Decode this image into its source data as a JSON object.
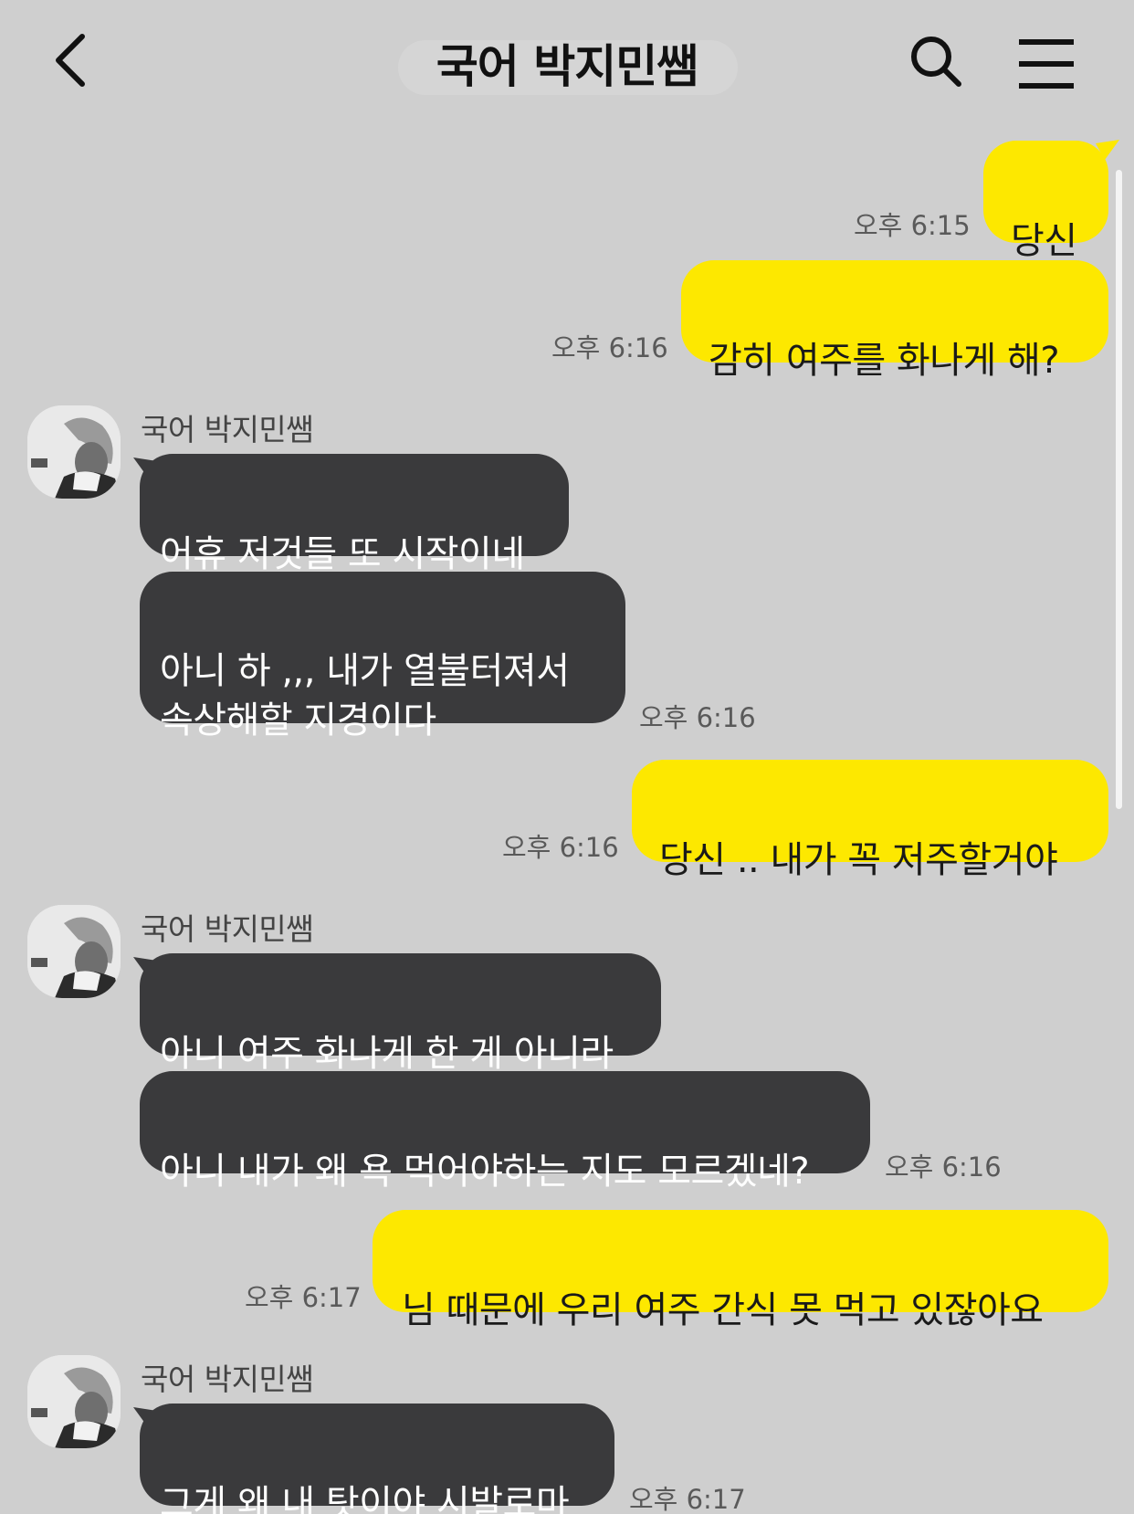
{
  "header": {
    "title": "국어 박지민쌤"
  },
  "messages": [
    {
      "text": "당신",
      "time": "오후 6:15"
    },
    {
      "text": "감히 여주를 화나게 해?",
      "time": "오후 6:16"
    },
    {
      "sender": "국어 박지민쌤"
    },
    {
      "text": "어휴 저것들 또 시작이네"
    },
    {
      "text": "아니 하 ,,, 내가 열불터져서\n속상해할 지경이다",
      "time": "오후 6:16"
    },
    {
      "text": "당신 .. 내가 꼭 저주할거야",
      "time": "오후 6:16"
    },
    {
      "sender": "국어 박지민쌤"
    },
    {
      "text": "아니 여주 화나게 한 게 아니라"
    },
    {
      "text": "아니 내가 왜 욕 먹어야하는 지도 모르겠네?",
      "time": "오후 6:16"
    },
    {
      "text": "님 때문에 우리 여주 간식 못 먹고 있잖아요",
      "time": "오후 6:17"
    },
    {
      "sender": "국어 박지민쌤"
    },
    {
      "text": "그게 왜 내 탓이야 시발로마",
      "time": "오후 6:17"
    }
  ],
  "colors": {
    "background": "#cfcfcf",
    "my_bubble": "#fde800",
    "their_bubble": "#3a3a3c"
  },
  "icons": [
    "chevron-left-icon",
    "search-icon",
    "hamburger-menu-icon",
    "avatar-photo"
  ]
}
